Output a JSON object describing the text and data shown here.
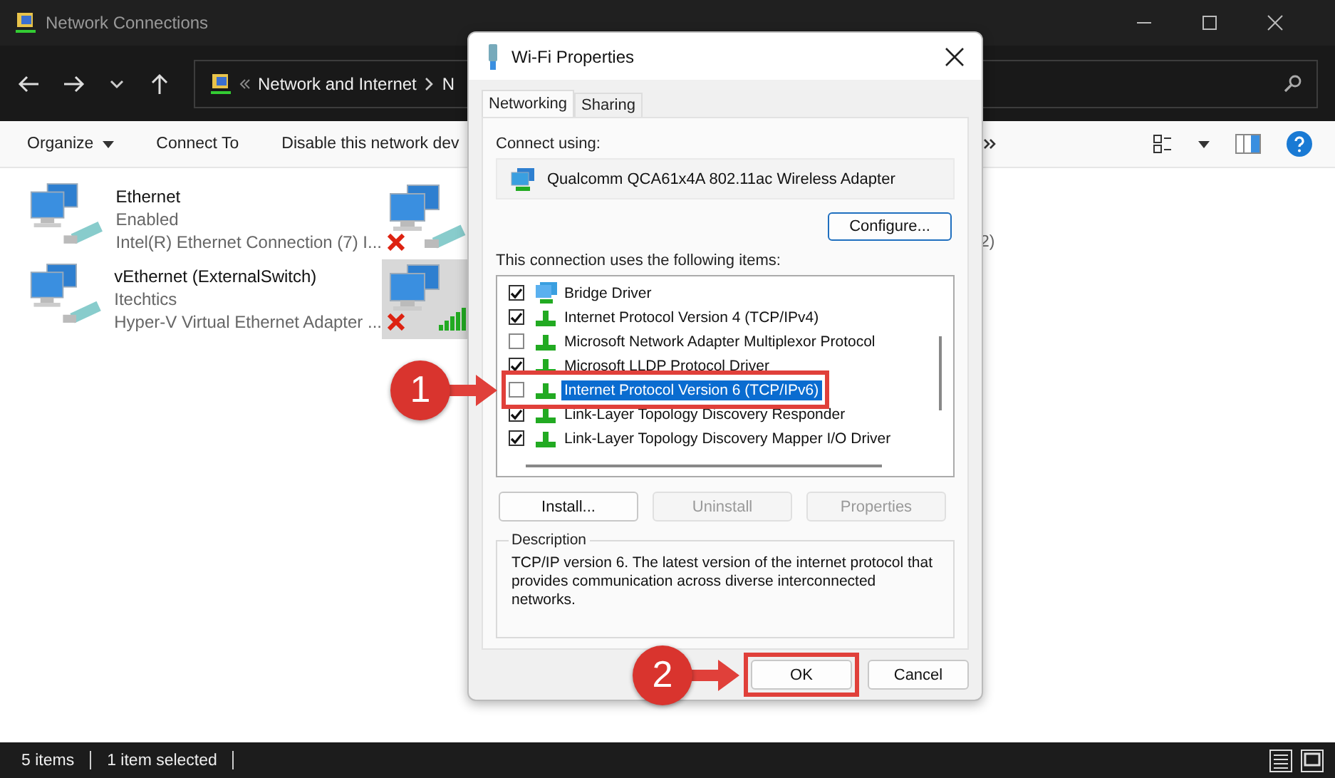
{
  "explorer": {
    "title": "Network Connections",
    "breadcrumb": [
      "Network and Internet",
      "N"
    ],
    "commands": [
      "Organize",
      "Connect To",
      "Disable this network dev"
    ],
    "connections": [
      {
        "name": "Ethernet",
        "status": "Enabled",
        "device": "Intel(R) Ethernet Connection (7) I..."
      },
      {
        "name": "vEthernet (ExternalSwitch)",
        "status": "Itechtics",
        "device": "Hyper-V Virtual Ethernet Adapter ..."
      }
    ],
    "hidden_connections": [
      {
        "kind": "wired",
        "disconnected": true,
        "selected": false,
        "text_fragment": "2)"
      },
      {
        "kind": "wifi",
        "disconnected": true,
        "selected": true
      }
    ],
    "status_bar": [
      "5 items",
      "1 item selected"
    ]
  },
  "dialog": {
    "title": "Wi-Fi Properties",
    "tabs": [
      {
        "label": "Networking",
        "selected": true
      },
      {
        "label": "Sharing",
        "selected": false
      }
    ],
    "connect_label": "Connect using:",
    "adapter": "Qualcomm QCA61x4A 802.11ac Wireless Adapter",
    "configure": "Configure...",
    "items_label": "This connection uses the following items:",
    "items": [
      {
        "label": "Bridge Driver",
        "checked": true,
        "selected": false,
        "kind": "bridge"
      },
      {
        "label": "Internet Protocol Version 4 (TCP/IPv4)",
        "checked": true,
        "selected": false,
        "kind": "protocol"
      },
      {
        "label": "Microsoft Network Adapter Multiplexor Protocol",
        "checked": false,
        "selected": false,
        "kind": "protocol"
      },
      {
        "label": "Microsoft LLDP Protocol Driver",
        "checked": true,
        "selected": false,
        "kind": "protocol"
      },
      {
        "label": "Internet Protocol Version 6 (TCP/IPv6)",
        "checked": false,
        "selected": true,
        "kind": "protocol"
      },
      {
        "label": "Link-Layer Topology Discovery Responder",
        "checked": true,
        "selected": false,
        "kind": "protocol"
      },
      {
        "label": "Link-Layer Topology Discovery Mapper I/O Driver",
        "checked": true,
        "selected": false,
        "kind": "protocol"
      }
    ],
    "buttons": [
      {
        "label": "Install...",
        "disabled": false
      },
      {
        "label": "Uninstall",
        "disabled": true
      },
      {
        "label": "Properties",
        "disabled": true
      }
    ],
    "description_label": "Description",
    "description": "TCP/IP version 6. The latest version of the internet protocol that provides communication across diverse interconnected networks.",
    "ok": "OK",
    "cancel": "Cancel"
  },
  "annotations": [
    {
      "text": "1",
      "kind": "row"
    },
    {
      "text": "2",
      "kind": "button"
    }
  ]
}
